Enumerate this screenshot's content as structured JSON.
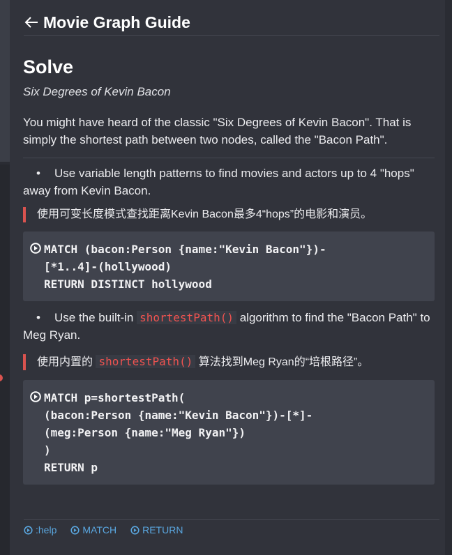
{
  "header": {
    "title": "Movie Graph Guide"
  },
  "section": {
    "heading": "Solve",
    "subtitle": "Six Degrees of Kevin Bacon",
    "intro": "You might have heard of the classic \"Six Degrees of Kevin Bacon\". That is simply the shortest path between two nodes, called the \"Bacon Path\"."
  },
  "items": [
    {
      "bullet": "•",
      "text": "Use variable length patterns to find movies and actors up to 4 \"hops\" away from Kevin Bacon.",
      "note": "使用可变长度模式查找距离Kevin Bacon最多4“hops”的电影和演员。",
      "code_lines": [
        "MATCH (bacon:Person {name:\"Kevin Bacon\"})-",
        "[*1..4]-(hollywood)",
        "RETURN DISTINCT hollywood"
      ]
    },
    {
      "bullet": "•",
      "text_before": "Use the built-in",
      "inline_code": "shortestPath()",
      "text_after": "algorithm to find the \"Bacon Path\" to Meg Ryan.",
      "note_before": "使用内置的",
      "note_code": "shortestPath()",
      "note_after": "算法找到Meg Ryan的“培根路径”。",
      "code_lines": [
        "MATCH p=shortestPath(",
        "(bacon:Person {name:\"Kevin Bacon\"})-[*]-",
        "(meg:Person {name:\"Meg Ryan\"})",
        ")",
        "RETURN p"
      ]
    }
  ],
  "footer": {
    "links": [
      ":help",
      "MATCH",
      "RETURN"
    ]
  },
  "colors": {
    "accent_red": "#d9534f",
    "link_blue": "#5aa7e0",
    "panel_bg": "#31333b",
    "code_bg": "#40434d"
  },
  "icons": [
    "back-arrow-icon",
    "play-circle-icon"
  ]
}
